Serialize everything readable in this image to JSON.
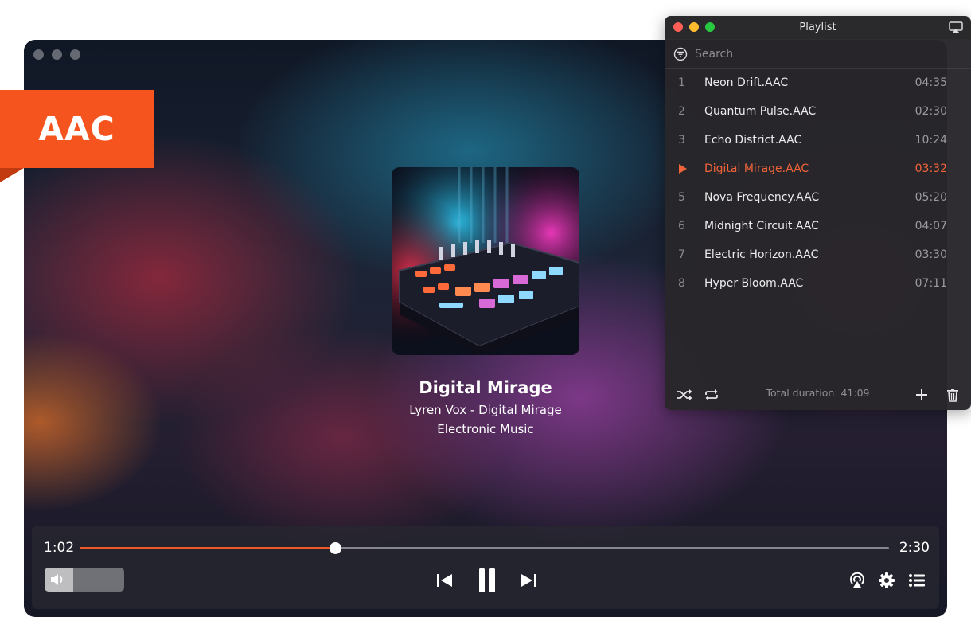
{
  "badge": {
    "label": "AAC",
    "color": "#f6541f"
  },
  "player": {
    "track_title": "Digital Mirage",
    "artist_album": "Lyren Vox - Digital Mirage",
    "genre": "Electronic Music",
    "elapsed": "1:02",
    "total": "2:30",
    "progress": 0.3155,
    "volume": 0.36,
    "accent_color": "#f05a28",
    "icons": {
      "volume": "speaker-icon",
      "previous": "skip-back-icon",
      "pause": "pause-icon",
      "next": "skip-forward-icon",
      "airplay": "airplay-icon",
      "settings": "gear-icon",
      "playlist": "list-icon"
    }
  },
  "playlist": {
    "title": "Playlist",
    "search_placeholder": "Search",
    "items": [
      {
        "num": "1",
        "name": "Neon Drift.AAC",
        "duration": "04:35",
        "active": false
      },
      {
        "num": "2",
        "name": "Quantum Pulse.AAC",
        "duration": "02:30",
        "active": false
      },
      {
        "num": "3",
        "name": "Echo District.AAC",
        "duration": "10:24",
        "active": false
      },
      {
        "num": "",
        "name": "Digital Mirage.AAC",
        "duration": "03:32",
        "active": true
      },
      {
        "num": "5",
        "name": "Nova Frequency.AAC",
        "duration": "05:20",
        "active": false
      },
      {
        "num": "6",
        "name": "Midnight Circuit.AAC",
        "duration": "04:07",
        "active": false
      },
      {
        "num": "7",
        "name": "Electric Horizon.AAC",
        "duration": "03:30",
        "active": false
      },
      {
        "num": "8",
        "name": "Hyper Bloom.AAC",
        "duration": "07:11",
        "active": false
      }
    ],
    "total_duration": "Total duration: 41:09",
    "active_color": "#f2643a",
    "window_dot_colors": [
      "#ff5f57",
      "#febc2e",
      "#28c840"
    ],
    "icons": {
      "shuffle": "shuffle-icon",
      "repeat": "repeat-icon",
      "add": "plus-icon",
      "delete": "trash-icon",
      "search": "search-icon",
      "now_playing": "play-triangle-icon"
    }
  }
}
